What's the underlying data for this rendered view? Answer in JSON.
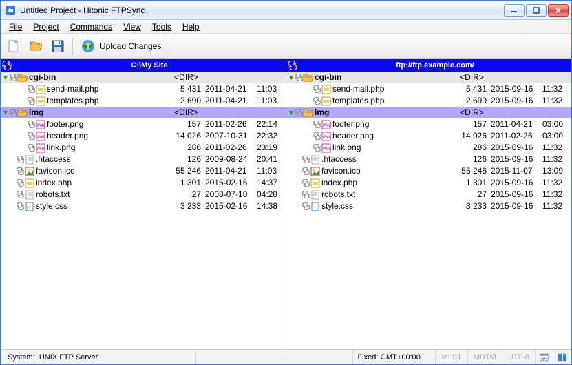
{
  "window": {
    "title": "Untitled Project - Hitonic FTPSync"
  },
  "menu": {
    "file": "File",
    "project": "Project",
    "commands": "Commands",
    "view": "View",
    "tools": "Tools",
    "help": "Help"
  },
  "toolbar": {
    "upload_label": "Upload Changes"
  },
  "panes": {
    "left": {
      "title": "C:\\My Site",
      "rows": [
        {
          "type": "dir",
          "indent": 1,
          "expanded": true,
          "sync": "sync",
          "icon": "folder-open",
          "name": "cgi-bin",
          "dirlabel": "<DIR>",
          "bold": true,
          "selected": false
        },
        {
          "type": "file",
          "indent": 3,
          "sync": "sync",
          "icon": "php",
          "name": "send-mail.php",
          "size": "5 431",
          "date": "2011-04-21",
          "time": "11:03"
        },
        {
          "type": "file",
          "indent": 3,
          "sync": "sync",
          "icon": "php",
          "name": "templates.php",
          "size": "2 690",
          "date": "2011-04-21",
          "time": "11:03"
        },
        {
          "type": "dir",
          "indent": 1,
          "expanded": true,
          "sync": "sync",
          "icon": "folder-open",
          "name": "img",
          "dirlabel": "<DIR>",
          "bold": true,
          "selected": true
        },
        {
          "type": "file",
          "indent": 3,
          "sync": "sync",
          "icon": "png",
          "name": "footer.png",
          "size": "157",
          "date": "2011-02-26",
          "time": "22:14"
        },
        {
          "type": "file",
          "indent": 3,
          "sync": "sync",
          "icon": "png",
          "name": "header.png",
          "size": "14 026",
          "date": "2007-10-31",
          "time": "22:32"
        },
        {
          "type": "file",
          "indent": 3,
          "sync": "sync",
          "icon": "png",
          "name": "link.png",
          "size": "286",
          "date": "2011-02-26",
          "time": "23:19"
        },
        {
          "type": "file",
          "indent": 2,
          "sync": "sync",
          "icon": "txt",
          "name": ".htaccess",
          "size": "126",
          "date": "2009-08-24",
          "time": "20:41"
        },
        {
          "type": "file",
          "indent": 2,
          "sync": "sync",
          "icon": "ico",
          "name": "favicon.ico",
          "size": "55 246",
          "date": "2011-04-21",
          "time": "11:03"
        },
        {
          "type": "file",
          "indent": 2,
          "sync": "sync",
          "icon": "php",
          "name": "index.php",
          "size": "1 301",
          "date": "2015-02-16",
          "time": "14:37"
        },
        {
          "type": "file",
          "indent": 2,
          "sync": "sync",
          "icon": "txt",
          "name": "robots.txt",
          "size": "27",
          "date": "2008-07-10",
          "time": "04:28"
        },
        {
          "type": "file",
          "indent": 2,
          "sync": "sync",
          "icon": "css",
          "name": "style.css",
          "size": "3 233",
          "date": "2015-02-16",
          "time": "14:38"
        }
      ]
    },
    "right": {
      "title": "ftp://ftp.example.com/",
      "rows": [
        {
          "type": "dir",
          "indent": 1,
          "expanded": true,
          "sync": "sync",
          "icon": "folder-open",
          "name": "cgi-bin",
          "dirlabel": "<DIR>",
          "bold": true,
          "selected": false
        },
        {
          "type": "file",
          "indent": 3,
          "sync": "sync",
          "icon": "php",
          "name": "send-mail.php",
          "size": "5 431",
          "date": "2015-09-16",
          "time": "11:32"
        },
        {
          "type": "file",
          "indent": 3,
          "sync": "sync",
          "icon": "php",
          "name": "templates.php",
          "size": "2 690",
          "date": "2015-09-16",
          "time": "11:32"
        },
        {
          "type": "dir",
          "indent": 1,
          "expanded": true,
          "sync": "sync",
          "icon": "folder-open",
          "name": "img",
          "dirlabel": "<DIR>",
          "bold": true,
          "selected": true
        },
        {
          "type": "file",
          "indent": 3,
          "sync": "sync",
          "icon": "png",
          "name": "footer.png",
          "size": "157",
          "date": "2011-04-21",
          "time": "03:00"
        },
        {
          "type": "file",
          "indent": 3,
          "sync": "sync",
          "icon": "png",
          "name": "header.png",
          "size": "14 026",
          "date": "2011-02-26",
          "time": "03:00"
        },
        {
          "type": "file",
          "indent": 3,
          "sync": "sync",
          "icon": "png",
          "name": "link.png",
          "size": "286",
          "date": "2015-09-16",
          "time": "11:32"
        },
        {
          "type": "file",
          "indent": 2,
          "sync": "sync",
          "icon": "txt",
          "name": ".htaccess",
          "size": "126",
          "date": "2015-09-16",
          "time": "11:32"
        },
        {
          "type": "file",
          "indent": 2,
          "sync": "sync",
          "icon": "ico",
          "name": "favicon.ico",
          "size": "55 246",
          "date": "2015-11-07",
          "time": "13:09"
        },
        {
          "type": "file",
          "indent": 2,
          "sync": "sync",
          "icon": "php",
          "name": "index.php",
          "size": "1 301",
          "date": "2015-09-16",
          "time": "11:32"
        },
        {
          "type": "file",
          "indent": 2,
          "sync": "sync",
          "icon": "txt",
          "name": "robots.txt",
          "size": "27",
          "date": "2015-09-16",
          "time": "11:32"
        },
        {
          "type": "file",
          "indent": 2,
          "sync": "sync",
          "icon": "css",
          "name": "style.css",
          "size": "3 233",
          "date": "2015-09-16",
          "time": "11:32"
        }
      ]
    }
  },
  "status": {
    "system_label": "System:",
    "system_value": "UNIX FTP Server",
    "timezone": "Fixed: GMT+00:00",
    "tags": [
      "MLST",
      "MDTM",
      "UTF-8"
    ]
  }
}
